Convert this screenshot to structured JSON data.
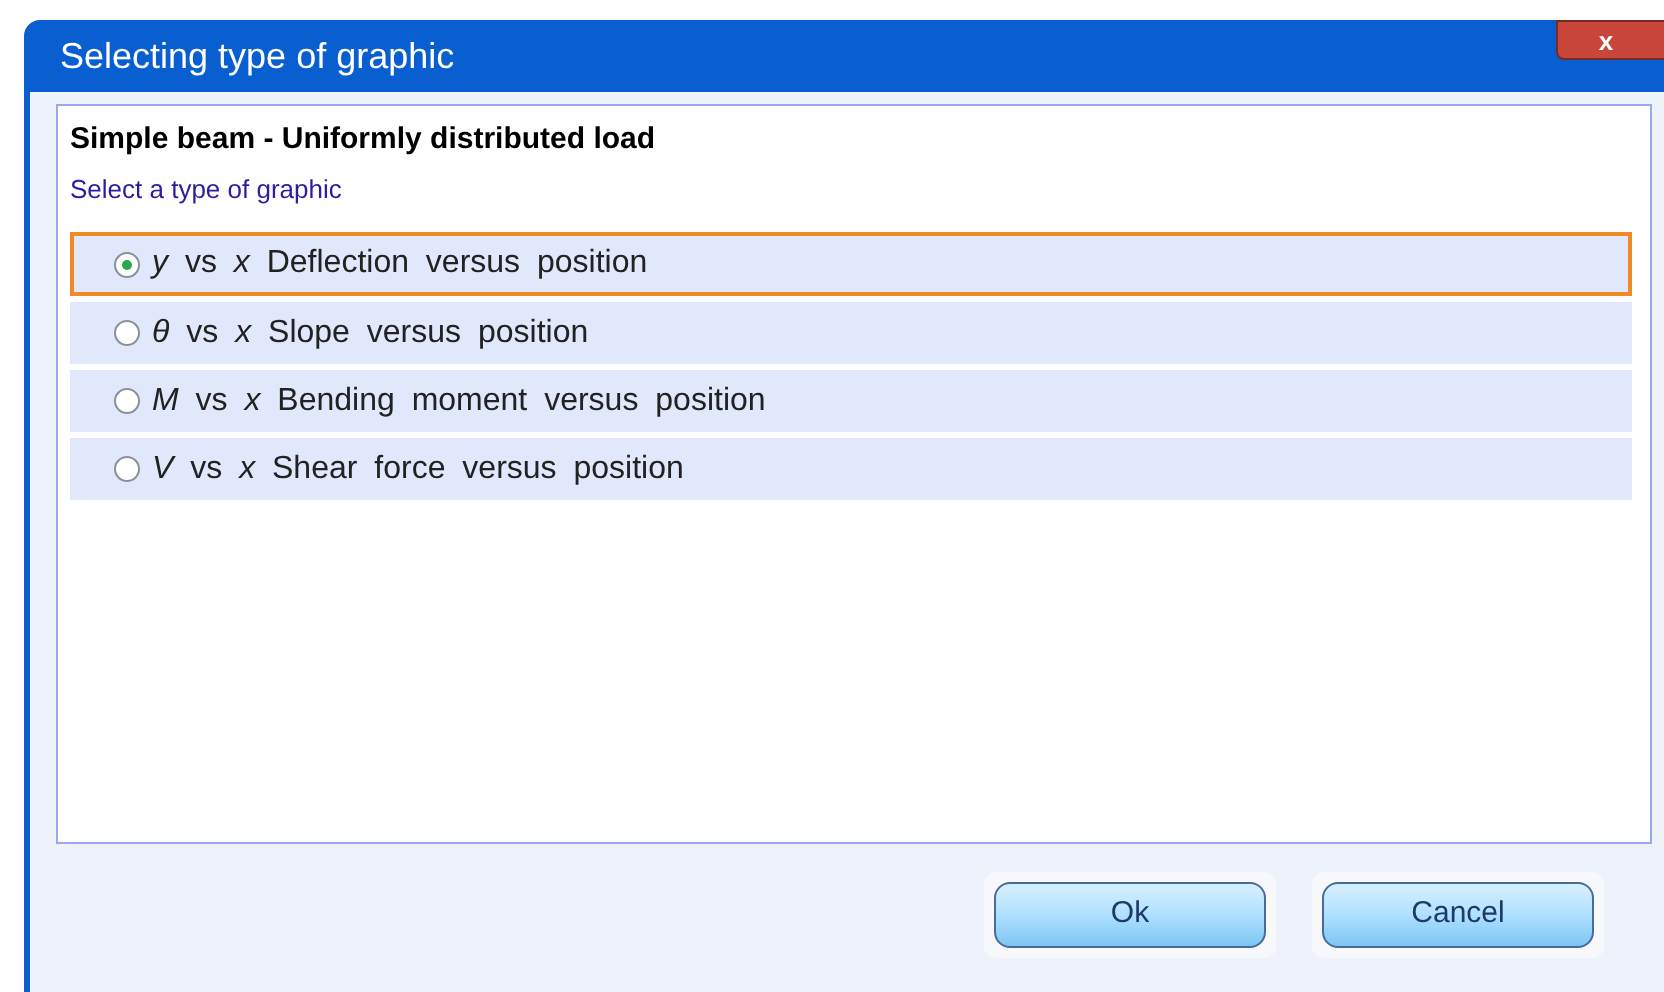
{
  "window": {
    "title": "Selecting type of graphic",
    "close": "x"
  },
  "heading": "Simple beam - Uniformly distributed load",
  "prompt": "Select a type of graphic",
  "options": [
    {
      "label": "*y* vs *x* Deflection versus position",
      "selected": true
    },
    {
      "label": "*θ* vs *x* Slope versus position",
      "selected": false
    },
    {
      "label": "*M* vs *x* Bending moment versus position",
      "selected": false
    },
    {
      "label": "*V* vs *x* Shear force versus position",
      "selected": false
    }
  ],
  "buttons": [
    "Ok",
    "Cancel"
  ]
}
